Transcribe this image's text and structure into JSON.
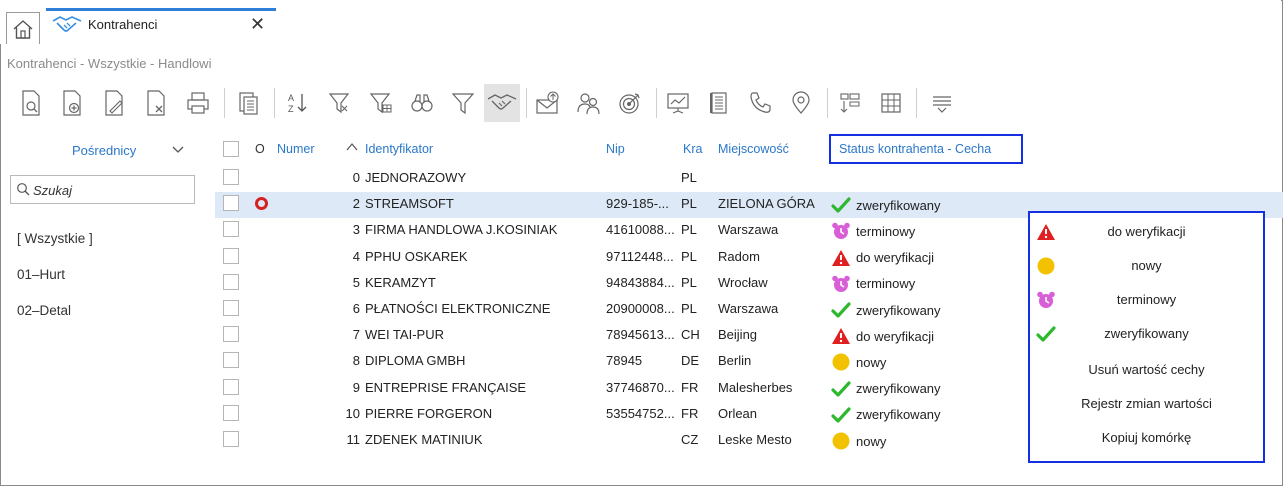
{
  "tabs": [
    {
      "label": "Kontrahenci"
    }
  ],
  "breadcrumb": "Kontrahenci - Wszystkie - Handlowi",
  "sidebar": {
    "header": "Pośrednicy",
    "search_placeholder": "Szukaj",
    "items": [
      "[ Wszystkie ]",
      "01–Hurt",
      "02–Detal"
    ]
  },
  "columns": {
    "o": "O",
    "numer": "Numer",
    "identyfikator": "Identyfikator",
    "nip": "Nip",
    "kra": "Kra",
    "miejscowosc": "Miejscowość",
    "status": "Status kontrahenta - Cecha"
  },
  "rows": [
    {
      "num": "0",
      "ident": "JEDNORAZOWY",
      "nip": "",
      "kra": "PL",
      "city": "",
      "status": "",
      "icon": ""
    },
    {
      "num": "2",
      "ident": "STREAMSOFT",
      "nip": "929-185-...",
      "kra": "PL",
      "city": "ZIELONA GÓRA",
      "status": "zweryfikowany",
      "icon": "check"
    },
    {
      "num": "3",
      "ident": "FIRMA HANDLOWA J.KOSINIAK",
      "nip": "41610088...",
      "kra": "PL",
      "city": "Warszawa",
      "status": "terminowy",
      "icon": "alarm"
    },
    {
      "num": "4",
      "ident": "PPHU OSKAREK",
      "nip": "97112448...",
      "kra": "PL",
      "city": "Radom",
      "status": "do weryfikacji",
      "icon": "warning"
    },
    {
      "num": "5",
      "ident": "KERAMZYT",
      "nip": "94843884...",
      "kra": "PL",
      "city": "Wrocław",
      "status": "terminowy",
      "icon": "alarm"
    },
    {
      "num": "6",
      "ident": "PŁATNOŚCI ELEKTRONICZNE",
      "nip": "20900008...",
      "kra": "PL",
      "city": "Warszawa",
      "status": "zweryfikowany",
      "icon": "check"
    },
    {
      "num": "7",
      "ident": "WEI TAI-PUR",
      "nip": "78945613...",
      "kra": "CH",
      "city": "Beijing",
      "status": "do weryfikacji",
      "icon": "warning"
    },
    {
      "num": "8",
      "ident": "DIPLOMA GMBH",
      "nip": "78945",
      "kra": "DE",
      "city": "Berlin",
      "status": "nowy",
      "icon": "dot"
    },
    {
      "num": "9",
      "ident": "ENTREPRISE FRANÇAISE",
      "nip": "37746870...",
      "kra": "FR",
      "city": "Malesherbes",
      "status": "zweryfikowany",
      "icon": "check"
    },
    {
      "num": "10",
      "ident": "PIERRE FORGERON",
      "nip": "53554752...",
      "kra": "FR",
      "city": "Orlean",
      "status": "zweryfikowany",
      "icon": "check"
    },
    {
      "num": "11",
      "ident": "ZDENEK MATINIUK",
      "nip": "",
      "kra": "CZ",
      "city": "Leske Mesto",
      "status": "nowy",
      "icon": "dot"
    }
  ],
  "popup": {
    "items": [
      {
        "label": "do weryfikacji",
        "icon": "warning"
      },
      {
        "label": "nowy",
        "icon": "dot"
      },
      {
        "label": "terminowy",
        "icon": "alarm"
      },
      {
        "label": "zweryfikowany",
        "icon": "check"
      },
      {
        "label": "Usuń wartość cechy",
        "icon": ""
      },
      {
        "label": "Rejestr zmian wartości",
        "icon": ""
      },
      {
        "label": "Kopiuj komórkę",
        "icon": ""
      }
    ]
  },
  "colors": {
    "accent": "#2a78c8",
    "highlight_box": "#1530e0",
    "selected_row": "#dde9f6",
    "check": "#2eb82e",
    "warning": "#e02020",
    "dot": "#f2c200",
    "alarm": "#d85fd8"
  }
}
